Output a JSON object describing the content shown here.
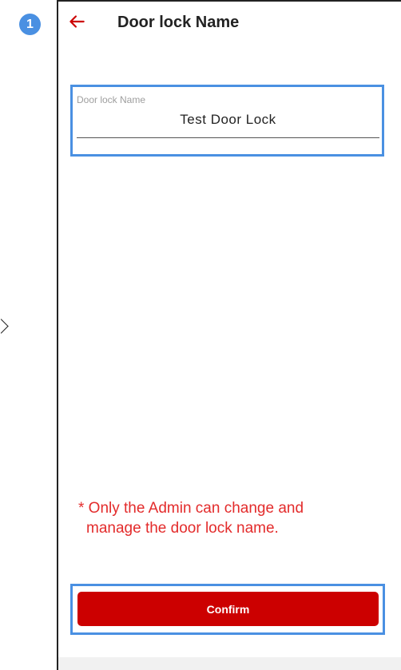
{
  "step_badge": "1",
  "app_bar": {
    "title": "Door lock Name",
    "back_icon": "arrow-left-icon"
  },
  "name_field": {
    "label": "Door lock Name",
    "value": "Test Door Lock"
  },
  "note": {
    "line1": "* Only the Admin can change and",
    "line2": "manage the door lock name."
  },
  "confirm_label": "Confirm",
  "colors": {
    "accent_red": "#cc0000",
    "highlight_blue": "#4a90e2",
    "note_red": "#e32b2b"
  }
}
